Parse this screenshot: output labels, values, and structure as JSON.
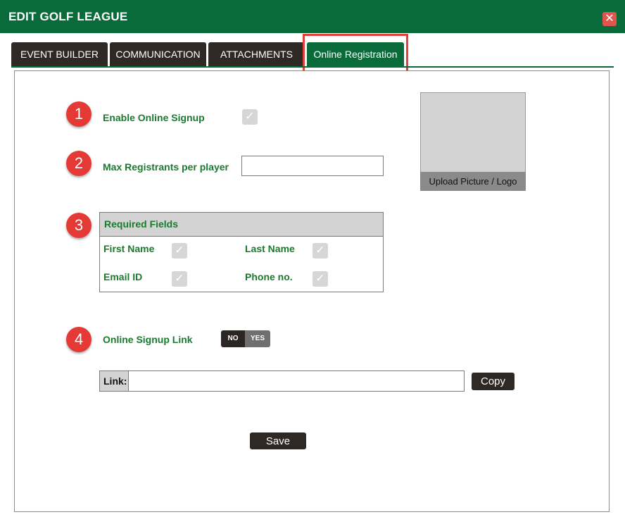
{
  "window": {
    "title": "EDIT GOLF LEAGUE",
    "close_glyph": "✕"
  },
  "tabs": [
    {
      "label": "EVENT BUILDER",
      "active": false
    },
    {
      "label": "COMMUNICATION",
      "active": false
    },
    {
      "label": "ATTACHMENTS",
      "active": false
    },
    {
      "label": "Online Registration",
      "active": true
    }
  ],
  "markers": [
    "1",
    "2",
    "3",
    "4"
  ],
  "form": {
    "enable_signup": {
      "label": "Enable Online Signup",
      "checked": true
    },
    "max_registrants": {
      "label": "Max Registrants per player",
      "value": ""
    },
    "required_fields": {
      "header": "Required Fields",
      "fields": [
        {
          "label": "First Name",
          "checked": true
        },
        {
          "label": "Last Name",
          "checked": true
        },
        {
          "label": "Email ID",
          "checked": true
        },
        {
          "label": "Phone no.",
          "checked": true
        }
      ]
    },
    "signup_link": {
      "label": "Online Signup Link",
      "toggle_no": "NO",
      "toggle_yes": "YES",
      "selected": "NO"
    },
    "link": {
      "prefix": "Link:",
      "value": ""
    },
    "copy_button": "Copy",
    "save_button": "Save"
  },
  "upload": {
    "label": "Upload Picture / Logo"
  },
  "colors": {
    "brand_green": "#0a6b3a",
    "label_green": "#1a7a2e",
    "dark": "#2f2926",
    "marker_red": "#e53935",
    "highlight_red": "#e2403b"
  },
  "icons": {
    "check": "✓"
  }
}
